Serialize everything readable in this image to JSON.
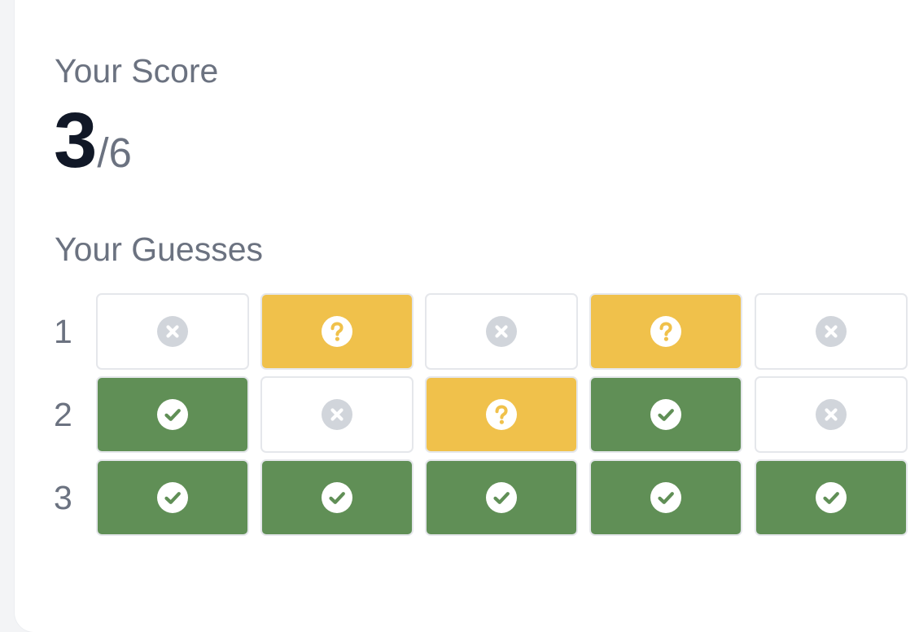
{
  "score": {
    "title": "Your Score",
    "value": "3",
    "total": "/6"
  },
  "guesses": {
    "title": "Your Guesses",
    "rows": [
      {
        "label": "1",
        "cells": [
          "miss",
          "present",
          "miss",
          "present",
          "miss"
        ]
      },
      {
        "label": "2",
        "cells": [
          "correct",
          "miss",
          "present",
          "correct",
          "miss"
        ]
      },
      {
        "label": "3",
        "cells": [
          "correct",
          "correct",
          "correct",
          "correct",
          "correct"
        ]
      }
    ]
  },
  "icons": {
    "miss": "x-circle-icon",
    "present": "question-circle-icon",
    "correct": "check-circle-icon"
  },
  "colors": {
    "miss_background": "#ffffff",
    "present_background": "#f0c14b",
    "correct_background": "#608f56",
    "miss_icon": "#d1d5db",
    "cell_border": "#e5e7eb",
    "text_muted": "#6b7280",
    "text_strong": "#111827"
  }
}
